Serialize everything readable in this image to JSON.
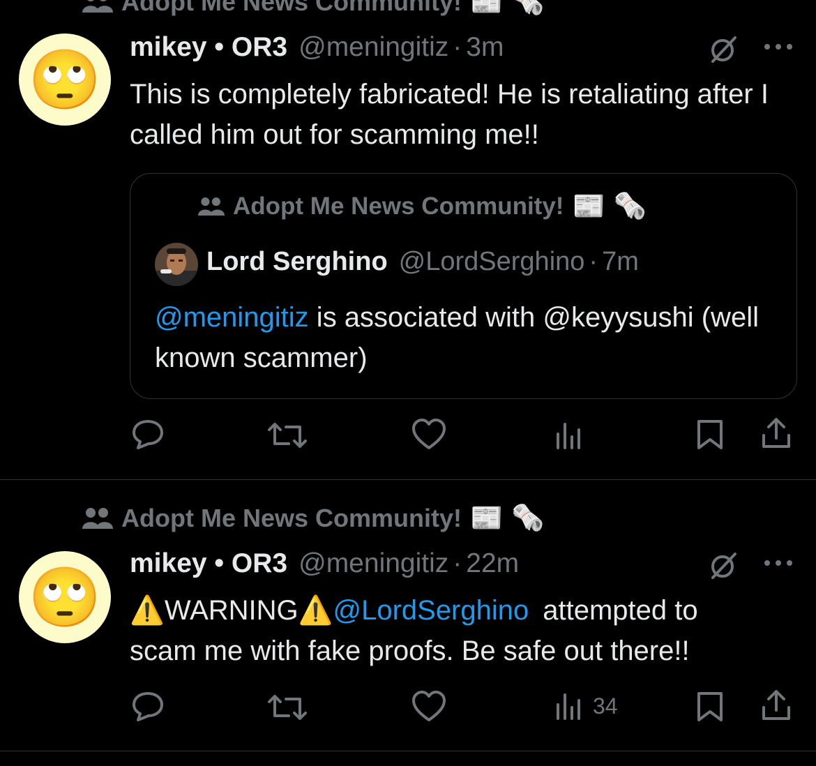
{
  "community_name": "Adopt Me News Community!",
  "community_emojis": [
    "📰",
    "🗞️"
  ],
  "tweets": [
    {
      "author_name": "mikey • OR3",
      "handle": "@meningitiz",
      "time": "3m",
      "avatar_emoji": "🙄",
      "text": "This is completely fabricated! He is retaliating after I called him out for scamming me!!",
      "quote": {
        "community_name": "Adopt Me News Community!",
        "author_name": "Lord Serghino",
        "handle": "@LordSerghino",
        "time": "7m",
        "mention": "@meningitiz",
        "text": " is associated with @keyysushi (well known scammer)"
      },
      "views": ""
    },
    {
      "author_name": "mikey • OR3",
      "handle": "@meningitiz",
      "time": "22m",
      "avatar_emoji": "🙄",
      "warning_icon": "⚠️",
      "warning_word": "WARNING",
      "mention": "@LordSerghino",
      "text_after_mention": "attempted to",
      "text_line2": "scam me with fake proofs. Be safe out there!!",
      "views": "34"
    }
  ],
  "icons": [
    "community-icon",
    "grok-icon",
    "more-icon",
    "reply-icon",
    "repost-icon",
    "like-icon",
    "views-icon",
    "bookmark-icon",
    "share-icon"
  ],
  "colors": {
    "background": "#000000",
    "text": "#e7e9ea",
    "muted": "#71767b",
    "accent": "#1d9bf0",
    "border": "#2f3336"
  }
}
